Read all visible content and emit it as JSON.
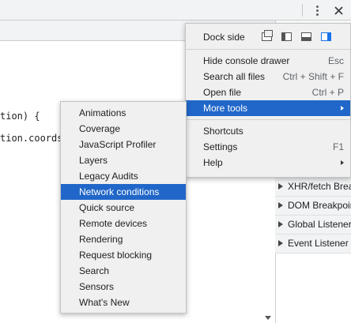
{
  "toolbar": {
    "icons": [
      "more-options-icon",
      "close-icon"
    ]
  },
  "code": {
    "line1": "tion) {",
    "line2": "tion.coords"
  },
  "side_pane": {
    "items": [
      {
        "label": "XHR/fetch Breakpoints"
      },
      {
        "label": "DOM Breakpoints"
      },
      {
        "label": "Global Listeners"
      },
      {
        "label": "Event Listener Breakpoints"
      }
    ]
  },
  "main_menu": {
    "dock_side_label": "Dock side",
    "dock_options": [
      "undock-into-separate-window",
      "dock-to-left",
      "dock-to-bottom",
      "dock-to-right"
    ],
    "dock_selected": "dock-to-right",
    "items": [
      {
        "label": "Hide console drawer",
        "shortcut": "Esc"
      },
      {
        "label": "Search all files",
        "shortcut": "Ctrl + Shift + F"
      },
      {
        "label": "Open file",
        "shortcut": "Ctrl + P"
      },
      {
        "label": "More tools",
        "shortcut": "",
        "submenu": true,
        "highlighted": true
      },
      {
        "label": "Shortcuts",
        "shortcut": ""
      },
      {
        "label": "Settings",
        "shortcut": "F1"
      },
      {
        "label": "Help",
        "shortcut": "",
        "submenu": true
      }
    ]
  },
  "more_tools_menu": {
    "items": [
      {
        "label": "Animations"
      },
      {
        "label": "Coverage"
      },
      {
        "label": "JavaScript Profiler"
      },
      {
        "label": "Layers"
      },
      {
        "label": "Legacy Audits"
      },
      {
        "label": "Network conditions",
        "highlighted": true
      },
      {
        "label": "Quick source"
      },
      {
        "label": "Remote devices"
      },
      {
        "label": "Rendering"
      },
      {
        "label": "Request blocking"
      },
      {
        "label": "Search"
      },
      {
        "label": "Sensors"
      },
      {
        "label": "What's New"
      }
    ]
  },
  "colors": {
    "highlight": "#2167c9",
    "menu_bg": "#f0f0f0",
    "toolbar_bg": "#f1f3f4",
    "dock_selected": "#1a73e8"
  }
}
